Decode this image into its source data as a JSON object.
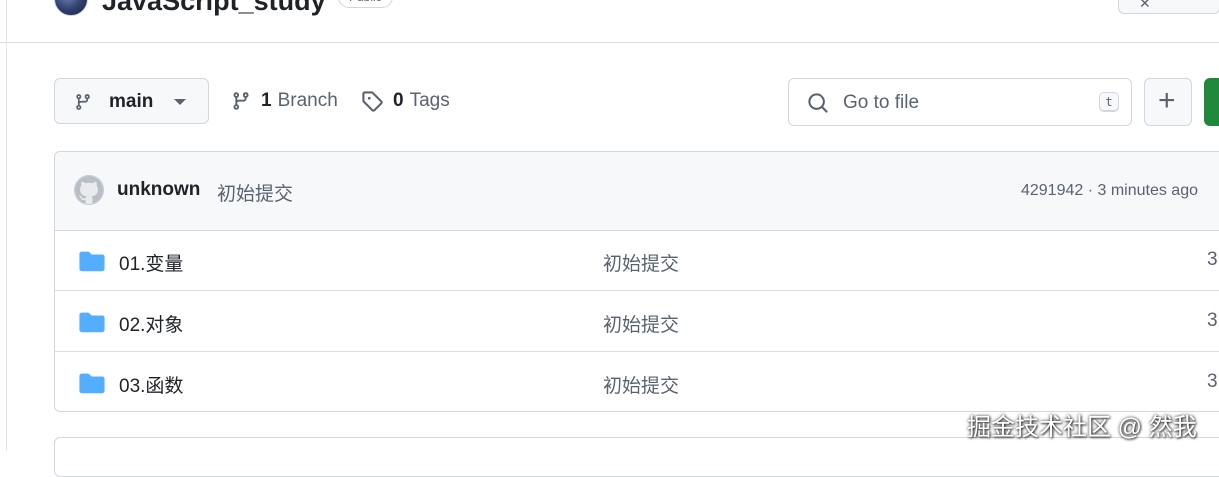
{
  "repo": {
    "name": "JavaScript_study",
    "visibility": "Public"
  },
  "toolbar": {
    "branch_name": "main",
    "branch_count": "1",
    "branch_label": "Branch",
    "tag_count": "0",
    "tag_label": "Tags",
    "search_placeholder": "Go to file",
    "search_shortcut": "t",
    "add_label": "+"
  },
  "latest_commit": {
    "author": "unknown",
    "message": "初始提交",
    "hash_time": "4291942 · 3 minutes ago"
  },
  "files": [
    {
      "name": "01.变量",
      "message": "初始提交",
      "date": "3"
    },
    {
      "name": "02.对象",
      "message": "初始提交",
      "date": "3"
    },
    {
      "name": "03.函数",
      "message": "初始提交",
      "date": "3"
    }
  ],
  "watermark": "掘金技术社区 @ 然我",
  "colors": {
    "accent_green": "#1f883d",
    "folder_blue": "#54aeff",
    "muted_text": "#59636e"
  },
  "icons": [
    "branch-icon",
    "tag-icon",
    "search-icon",
    "folder-icon",
    "github-avatar-icon"
  ]
}
